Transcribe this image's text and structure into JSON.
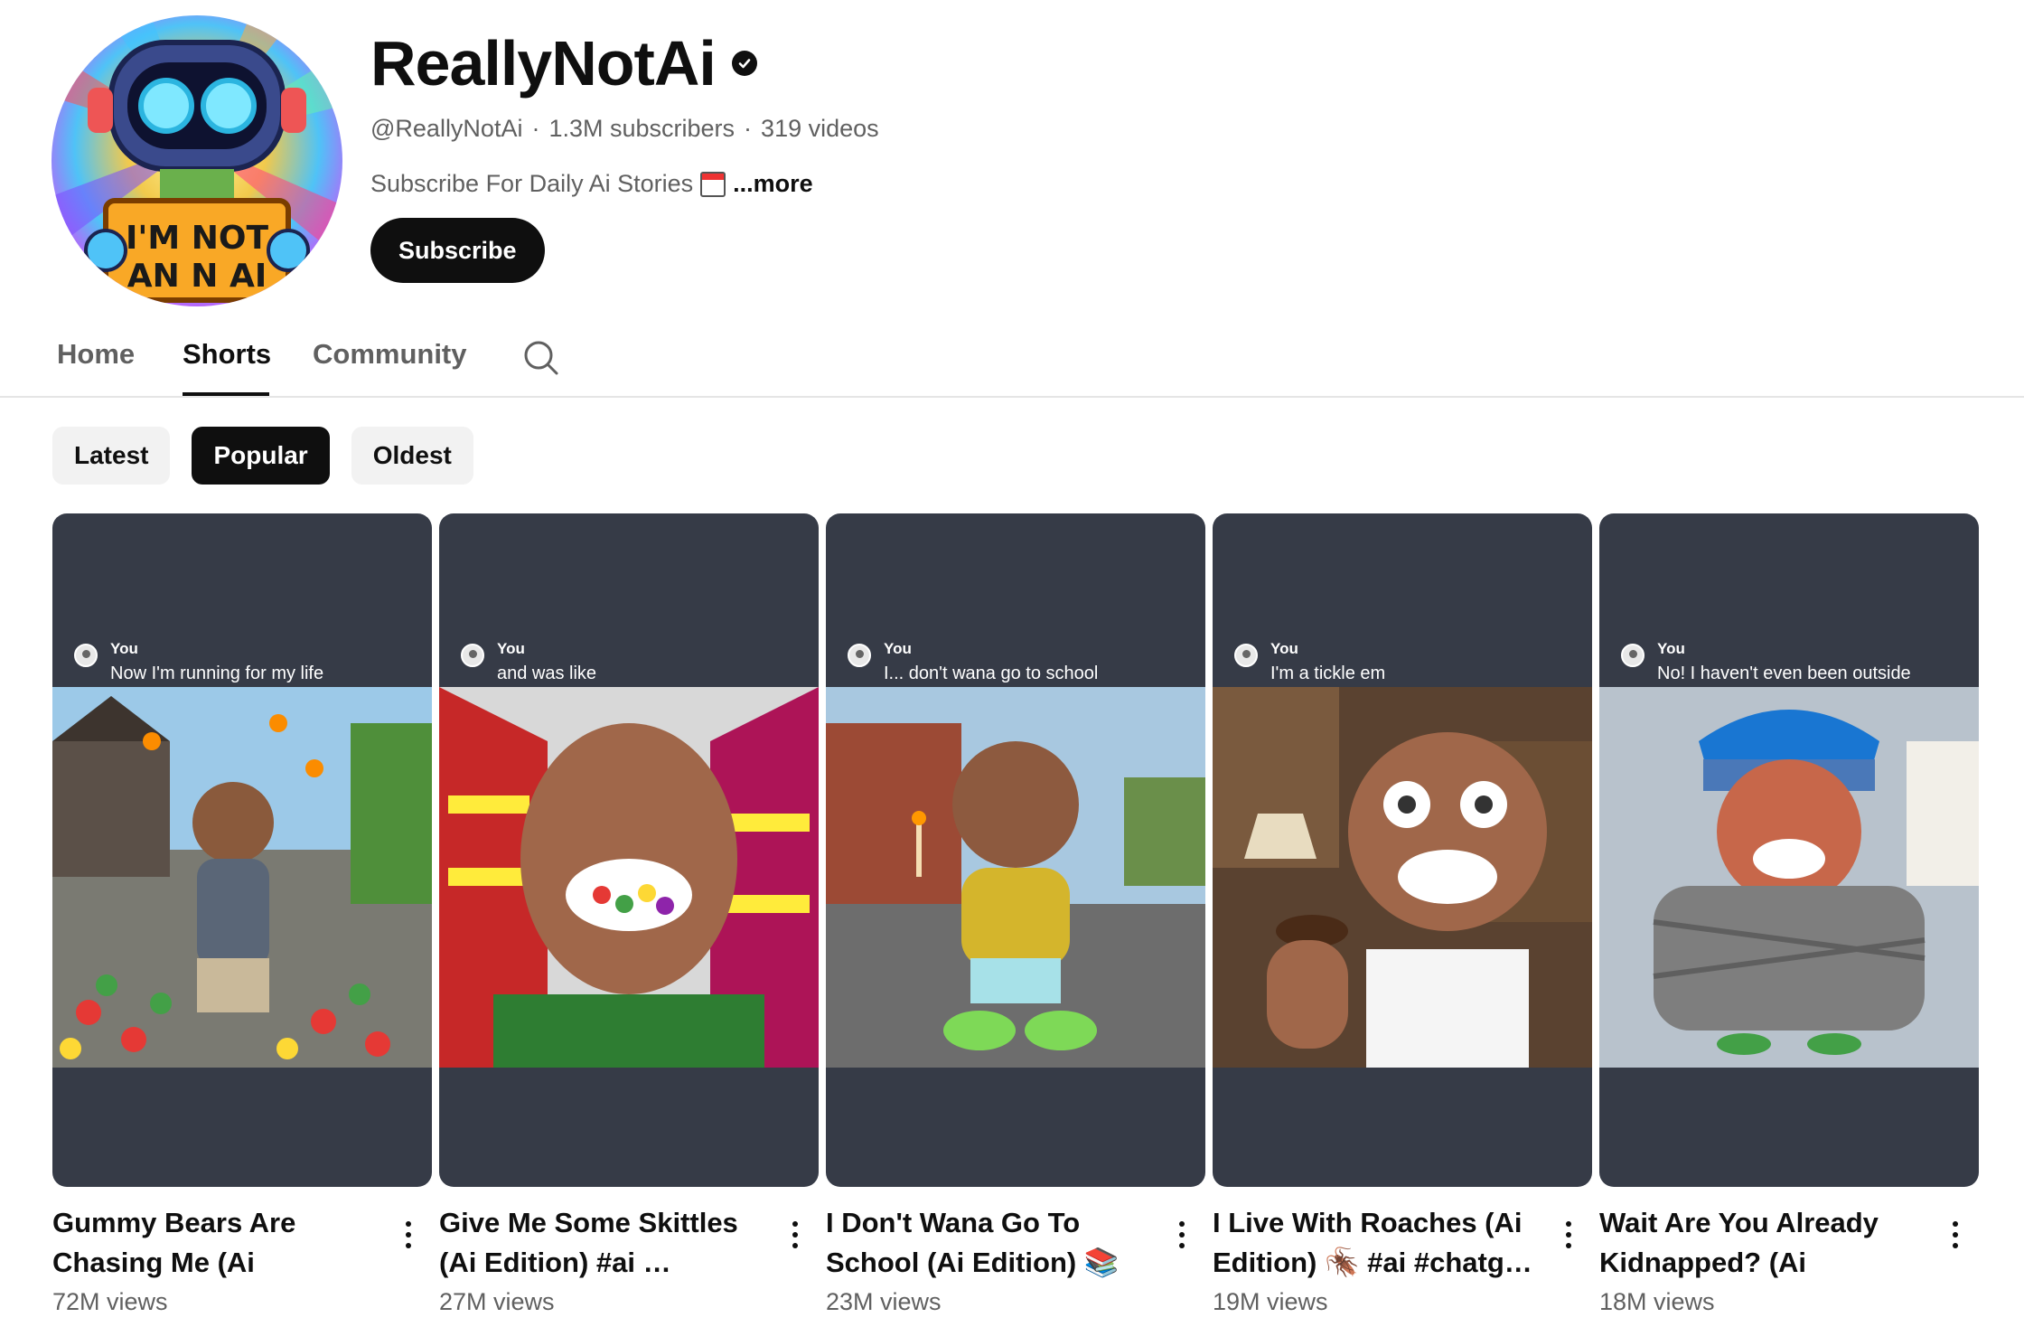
{
  "channel": {
    "name": "ReallyNotAi",
    "handle": "@ReallyNotAi",
    "subscribers": "1.3M subscribers",
    "videos": "319 videos",
    "description": "Subscribe For Daily Ai Stories",
    "more_label": "...more",
    "subscribe_label": "Subscribe",
    "avatar_sign_line1": "I'M NOT",
    "avatar_sign_line2": "AN N AI"
  },
  "tabs": [
    {
      "label": "Home",
      "active": false
    },
    {
      "label": "Shorts",
      "active": true
    },
    {
      "label": "Community",
      "active": false
    }
  ],
  "chips": [
    {
      "label": "Latest",
      "active": false
    },
    {
      "label": "Popular",
      "active": true
    },
    {
      "label": "Oldest",
      "active": false
    }
  ],
  "shorts": [
    {
      "caption_user": "You",
      "caption_text": "Now I'm running for my life",
      "title": "Gummy Bears Are Chasing Me (Ai Edition…",
      "views": "72M views",
      "art_color": "#6aa24b"
    },
    {
      "caption_user": "You",
      "caption_text": "and was like",
      "title": "Give Me Some Skittles (Ai Edition) #ai …",
      "views": "27M views",
      "art_color": "#2f8f4a"
    },
    {
      "caption_user": "You",
      "caption_text": "I... don't wana go to school",
      "title": "I Don't Wana Go To School (Ai Edition) 📚 …",
      "views": "23M views",
      "art_color": "#9b5a3c"
    },
    {
      "caption_user": "You",
      "caption_text": "I'm a tickle em",
      "title": "I Live With Roaches (Ai Edition) 🪳 #ai #chatg…",
      "views": "19M views",
      "art_color": "#6e4a2d"
    },
    {
      "caption_user": "You",
      "caption_text": "No! I haven't even been outside",
      "title": "Wait Are You Already Kidnapped? (Ai Edition…",
      "views": "18M views",
      "art_color": "#8a8d94"
    }
  ]
}
